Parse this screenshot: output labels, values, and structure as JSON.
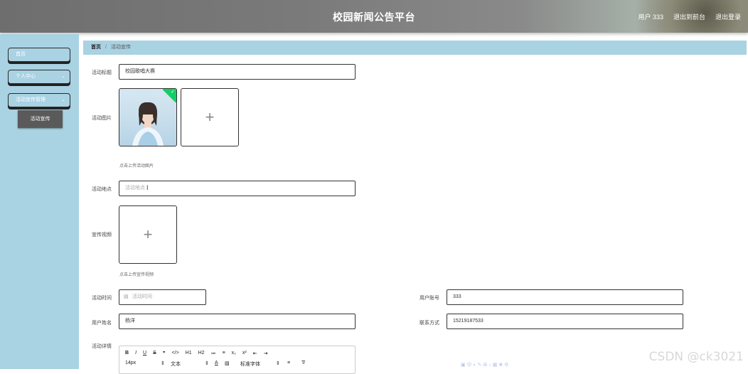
{
  "header": {
    "title": "校园新闻公告平台",
    "user_label": "用户 333",
    "back_to_front": "退出到前台",
    "logout": "退出登录"
  },
  "sidebar": {
    "items": [
      {
        "label": "首页"
      },
      {
        "label": "个人中心"
      },
      {
        "label": "活动宣传管理"
      }
    ],
    "sub_item": "活动宣传"
  },
  "breadcrumb": {
    "home": "首页",
    "separator": "/",
    "current": "活动宣传"
  },
  "form": {
    "title_label": "活动标题",
    "title_value": "校园歌唱大赛",
    "image_label": "活动图片",
    "image_tip": "点击上传活动图片",
    "location_label": "活动地点",
    "location_placeholder": "活动地点",
    "video_label": "宣传视频",
    "video_tip": "点击上传宣传视频",
    "time_label": "活动时间",
    "time_placeholder": "活动时间",
    "account_label": "用户账号",
    "account_value": "333",
    "name_label": "用户姓名",
    "name_value": "杨洋",
    "phone_label": "联系方式",
    "phone_value": "15219187533",
    "detail_label": "活动详情"
  },
  "editor": {
    "toolbar_row1": [
      "B",
      "I",
      "U",
      "S",
      "❞",
      "</>",
      "H1",
      "H2",
      "≔",
      "≡",
      "x₂",
      "x²",
      "⇤",
      "⇥"
    ],
    "font_size": "14px",
    "block_type": "文本",
    "font_family": "标准字体"
  },
  "watermark": "CSDN @ck3021",
  "colors": {
    "sidebar_bg": "#a9d2e3",
    "header_bg": "#7a7a7a",
    "success_badge": "#13ce66",
    "sub_menu_bg": "#5a5a5a"
  }
}
